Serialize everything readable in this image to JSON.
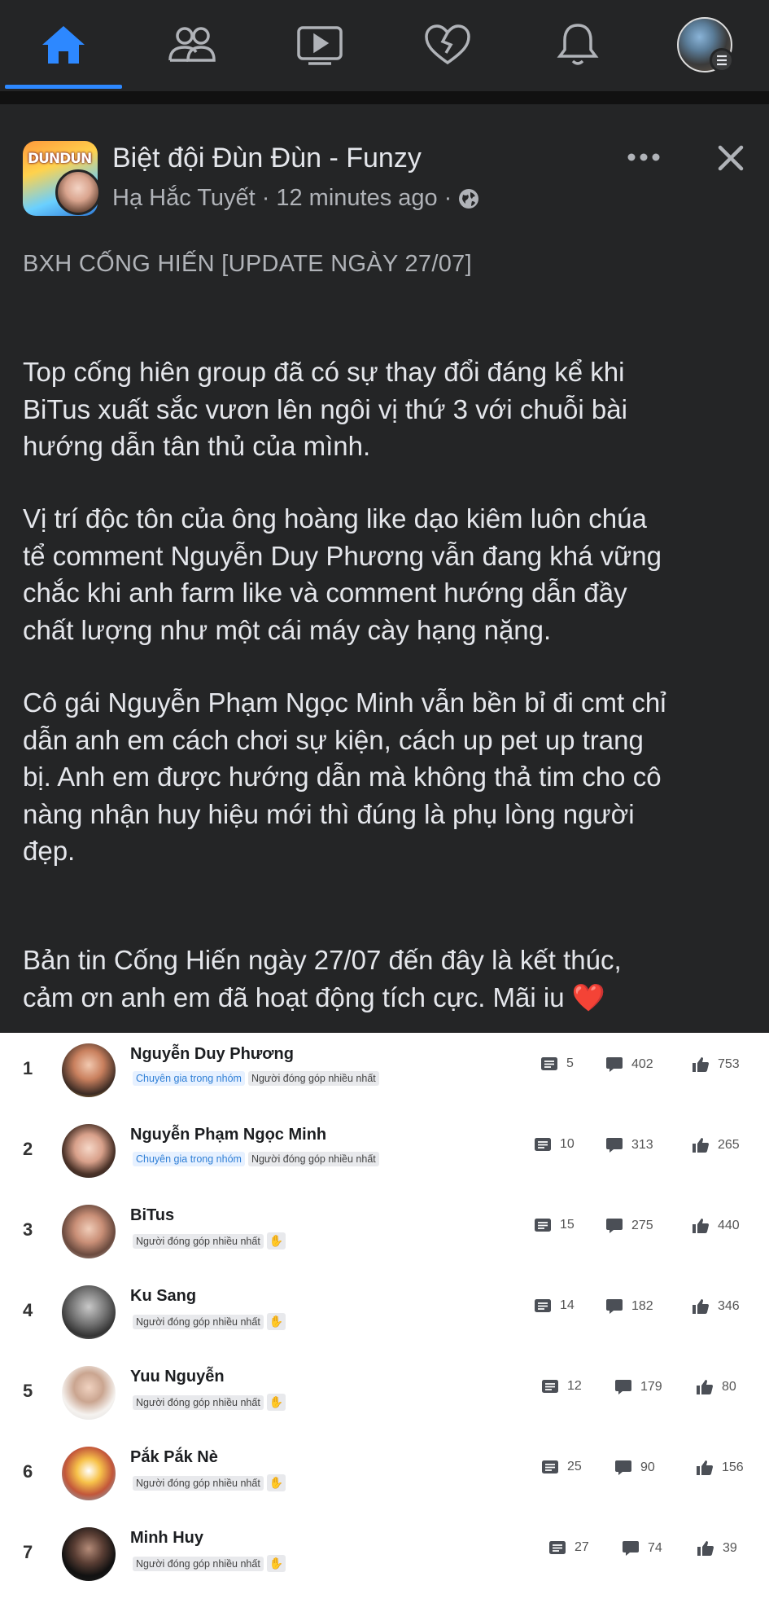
{
  "nav": {
    "tabs": [
      "home",
      "groups",
      "watch",
      "dating",
      "notifications",
      "profile"
    ],
    "active_color": "#2d88ff"
  },
  "post": {
    "group_name": "Biệt đội Đùn Đùn - Funzy",
    "author": "Hạ Hắc Tuyết",
    "separator": "·",
    "time": "12 minutes ago",
    "headline": "BXH CỐNG HIẾN [UPDATE NGÀY 27/07]",
    "paragraphs": [
      [
        "Top cống hiên group đã có sự thay đổi đáng kể khi",
        "BiTus xuất sắc vươn lên ngôi vị thứ 3 với chuỗi bài",
        "hướng dẫn tân thủ của mình."
      ],
      [
        "Vị trí độc tôn của ông hoàng like dạo kiêm luôn chúa",
        "tể comment Nguyễn Duy Phương vẫn đang khá vững",
        "chắc khi anh farm like và comment hướng dẫn đầy",
        "chất lượng như một cái máy cày hạng nặng."
      ],
      [
        "Cô gái Nguyễn Phạm Ngọc Minh vẫn bền bỉ đi cmt chỉ",
        "dẫn anh em cách chơi sự kiện, cách up pet up trang",
        "bị. Anh em được hướng dẫn mà không thả tim cho cô",
        "nàng nhận huy hiệu mới thì đúng là phụ lòng người",
        "đẹp."
      ],
      [
        "Bản tin Cống Hiến ngày 27/07 đến đây là kết thúc,",
        "cảm ơn anh em đã hoạt động tích cực. Mãi iu"
      ]
    ],
    "heart": "❤️",
    "page_avatar_text": "DUNDUN"
  },
  "leaderboard": [
    {
      "rank": "1",
      "name": "Nguyễn Duy Phương",
      "tags": [
        "Chuyên gia trong nhóm",
        "Người đóng góp nhiều nhất"
      ],
      "posts": "5",
      "comments": "402",
      "likes": "753"
    },
    {
      "rank": "2",
      "name": "Nguyễn Phạm Ngọc Minh",
      "tags": [
        "Chuyên gia trong nhóm",
        "Người đóng góp nhiều nhất"
      ],
      "posts": "10",
      "comments": "313",
      "likes": "265"
    },
    {
      "rank": "3",
      "name": "BiTus",
      "tags": [
        "Người đóng góp nhiều nhất"
      ],
      "posts": "15",
      "comments": "275",
      "likes": "440"
    },
    {
      "rank": "4",
      "name": "Ku Sang",
      "tags": [
        "Người đóng góp nhiều nhất"
      ],
      "posts": "14",
      "comments": "182",
      "likes": "346"
    },
    {
      "rank": "5",
      "name": "Yuu Nguyễn",
      "tags": [
        "Người đóng góp nhiều nhất"
      ],
      "posts": "12",
      "comments": "179",
      "likes": "80"
    },
    {
      "rank": "6",
      "name": "Pắk Pắk Nè",
      "tags": [
        "Người đóng góp nhiều nhất"
      ],
      "posts": "25",
      "comments": "90",
      "likes": "156"
    },
    {
      "rank": "7",
      "name": "Minh Huy",
      "tags": [
        "Người đóng góp nhiều nhất"
      ],
      "posts": "27",
      "comments": "74",
      "likes": "39"
    }
  ]
}
